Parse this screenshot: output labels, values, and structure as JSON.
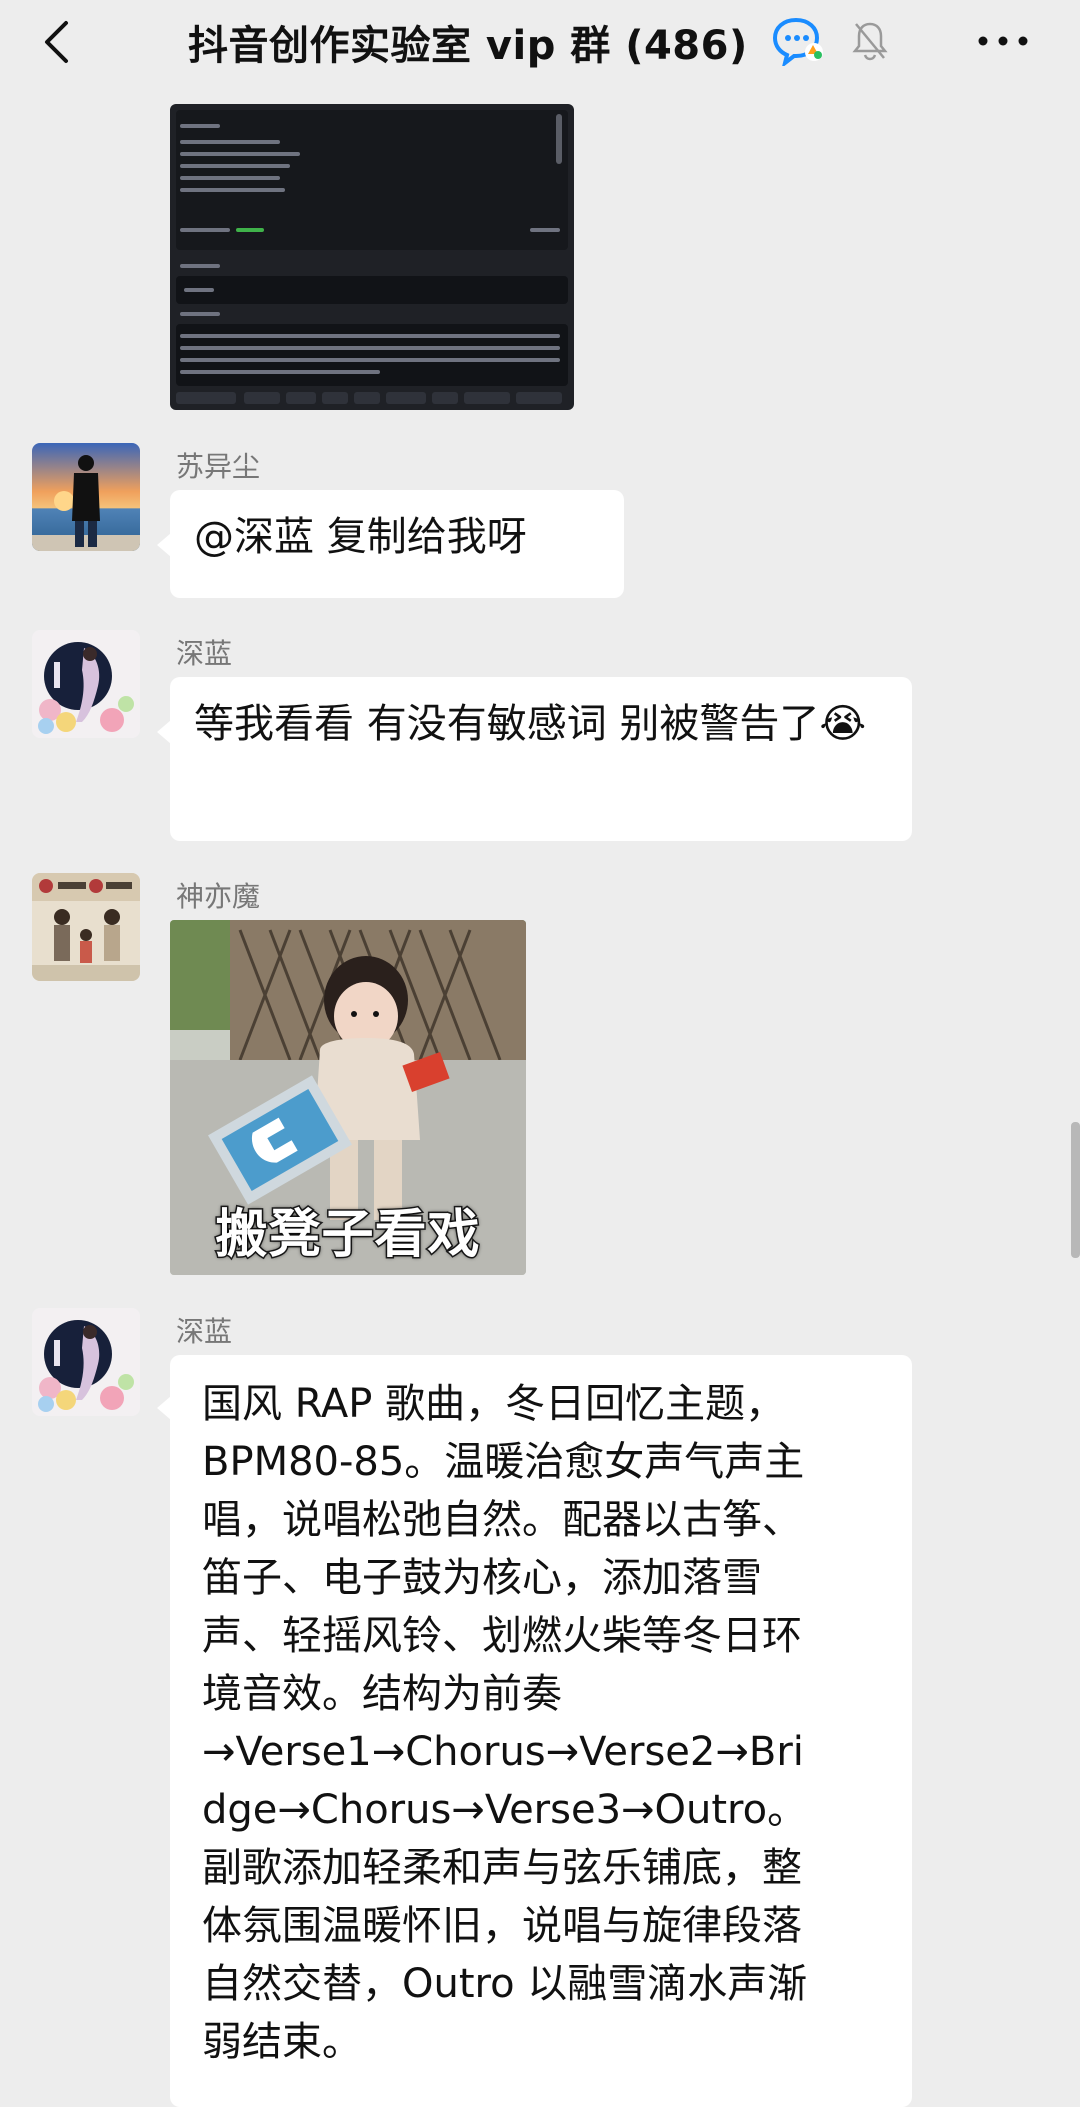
{
  "header": {
    "title": "抖音创作实验室 vip 群 (486)",
    "icons": [
      "back-icon",
      "group-chat-icon",
      "mute-bell-icon",
      "more-icon"
    ]
  },
  "messages": [
    {
      "type": "image",
      "sender": null,
      "content": "screenshot"
    },
    {
      "type": "text",
      "sender": "苏异尘",
      "text": "@深蓝  复制给我呀"
    },
    {
      "type": "text",
      "sender": "深蓝",
      "text": "等我看看  有没有敏感词 别被警告了😭"
    },
    {
      "type": "sticker",
      "sender": "神亦魔",
      "caption": "搬凳子看戏"
    },
    {
      "type": "text",
      "sender": "深蓝",
      "lines": [
        "国风 RAP 歌曲，冬日回忆主题，",
        "BPM80-85。温暖治愈女声气声主",
        "唱，说唱松弛自然。配器以古筝、",
        "笛子、电子鼓为核心，添加落雪",
        "声、轻摇风铃、划燃火柴等冬日环",
        "境音效。结构为前奏",
        "→Verse1→Chorus→Verse2→Bri",
        "dge→Chorus→Verse3→Outro。",
        "副歌添加轻柔和声与弦乐铺底，整",
        "体氛围温暖怀旧，说唱与旋律段落",
        "自然交替，Outro 以融雪滴水声渐",
        "弱结束。"
      ]
    }
  ],
  "colors": {
    "background": "#ededed",
    "bubble": "#ffffff",
    "name": "#777777"
  }
}
